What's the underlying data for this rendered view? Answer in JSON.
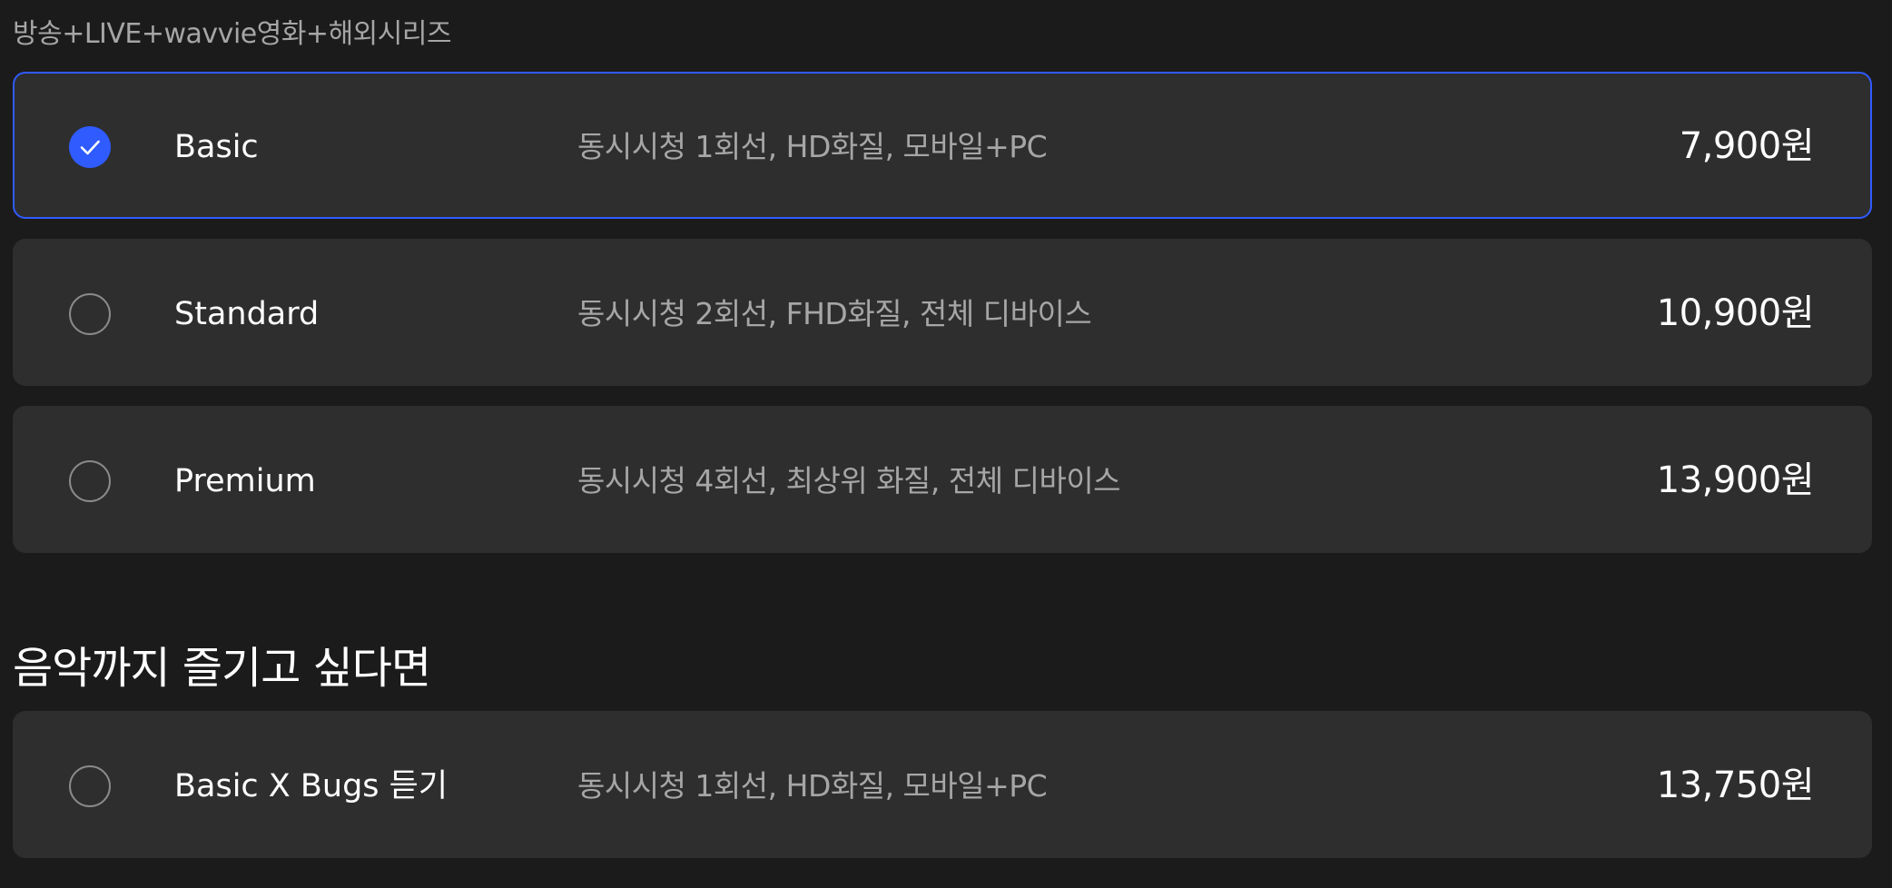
{
  "section_label": "방송+LIVE+wavvie영화+해외시리즈",
  "plans": [
    {
      "name": "Basic",
      "description": "동시시청 1회선, HD화질, 모바일+PC",
      "price": "7,900원",
      "selected": true
    },
    {
      "name": "Standard",
      "description": "동시시청 2회선, FHD화질, 전체 디바이스",
      "price": "10,900원",
      "selected": false
    },
    {
      "name": "Premium",
      "description": "동시시청 4회선, 최상위 화질, 전체 디바이스",
      "price": "13,900원",
      "selected": false
    }
  ],
  "music_section": {
    "title": "음악까지 즐기고 싶다면",
    "plans": [
      {
        "name": "Basic X Bugs 듣기",
        "description": "동시시청 1회선, HD화질, 모바일+PC",
        "price": "13,750원",
        "selected": false
      }
    ]
  },
  "colors": {
    "background": "#1b1b1b",
    "card": "#2e2e2e",
    "accent": "#2f5bff",
    "muted_text": "#a6a6a6"
  },
  "icons": {
    "selected": "check-icon"
  }
}
